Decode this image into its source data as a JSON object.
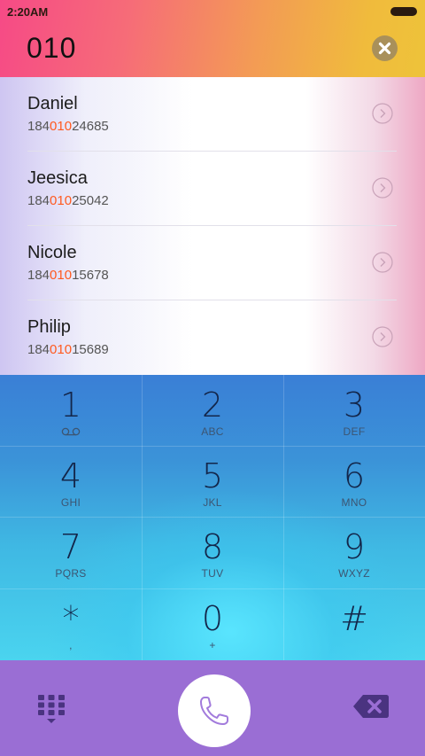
{
  "status_bar": {
    "time": "2:20AM"
  },
  "dialer": {
    "number": "010"
  },
  "contacts": [
    {
      "name": "Daniel",
      "number_pre": "184",
      "number_match": "010",
      "number_post": "24685"
    },
    {
      "name": "Jeesica",
      "number_pre": "184",
      "number_match": "010",
      "number_post": "25042"
    },
    {
      "name": "Nicole",
      "number_pre": "184",
      "number_match": "010",
      "number_post": "15678"
    },
    {
      "name": "Philip",
      "number_pre": "184",
      "number_match": "010",
      "number_post": "15689"
    }
  ],
  "keypad": [
    {
      "digit": "1",
      "letters": ""
    },
    {
      "digit": "2",
      "letters": "ABC"
    },
    {
      "digit": "3",
      "letters": "DEF"
    },
    {
      "digit": "4",
      "letters": "GHI"
    },
    {
      "digit": "5",
      "letters": "JKL"
    },
    {
      "digit": "6",
      "letters": "MNO"
    },
    {
      "digit": "7",
      "letters": "PQRS"
    },
    {
      "digit": "8",
      "letters": "TUV"
    },
    {
      "digit": "9",
      "letters": "WXYZ"
    },
    {
      "digit": "*",
      "letters": ","
    },
    {
      "digit": "0",
      "letters": "+"
    },
    {
      "digit": "#",
      "letters": ""
    }
  ],
  "icons": {
    "clear": "close-circle-icon",
    "detail": "chevron-right-circle-icon",
    "voicemail": "voicemail-icon",
    "dialpad": "dialpad-icon",
    "call": "phone-icon",
    "backspace": "backspace-icon"
  },
  "colors": {
    "match_highlight": "#ff5a1f",
    "bottom_bar": "#9a6ed4",
    "keypad_top": "#3a7fd6",
    "keypad_bottom": "#4ad4ef",
    "header_left": "#f64a86",
    "header_right": "#eec33a"
  }
}
